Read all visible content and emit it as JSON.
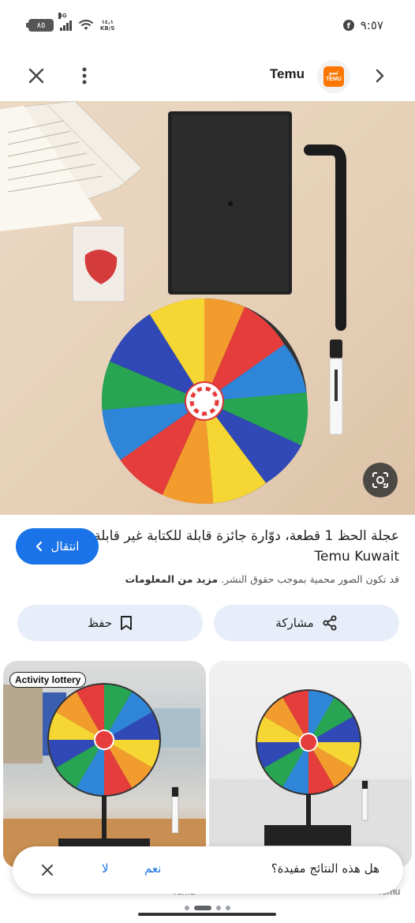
{
  "status_bar": {
    "battery": "٨٥",
    "network": "4G",
    "speed_value": "١٤٫١",
    "speed_unit": "KB/S",
    "time": "٩:٥٧"
  },
  "topbar": {
    "site_name": "Temu",
    "logo_text_top": "تيمو",
    "logo_text_bottom": "TEMU"
  },
  "result": {
    "title": "عجلة الحظ 1 قطعة، دوّارة جائزة قابلة للكتابة غير قابلة - Temu Kuwait",
    "visit_label": "انتقال",
    "copyright_text": "قد تكون الصور محمية بموجب حقوق النشر.",
    "more_info_label": "مزيد من المعلومات"
  },
  "actions": {
    "share_label": "مشاركة",
    "save_label": "حفظ"
  },
  "related": [
    {
      "overlay": "Activity lottery",
      "source": "Temu"
    },
    {
      "overlay": "",
      "source": "Temu"
    }
  ],
  "feedback": {
    "question": "هل هذه النتائج مفيدة؟",
    "yes_label": "نعم",
    "no_label": "لا"
  },
  "colors": {
    "accent": "#1a73e8",
    "chip_bg": "#e8eef9",
    "temu_orange": "#fb7701"
  },
  "icons": [
    "close-icon",
    "more-vert-icon",
    "chevron-right-icon",
    "lens-icon",
    "chevron-left-icon",
    "share-icon",
    "bookmark-icon"
  ]
}
